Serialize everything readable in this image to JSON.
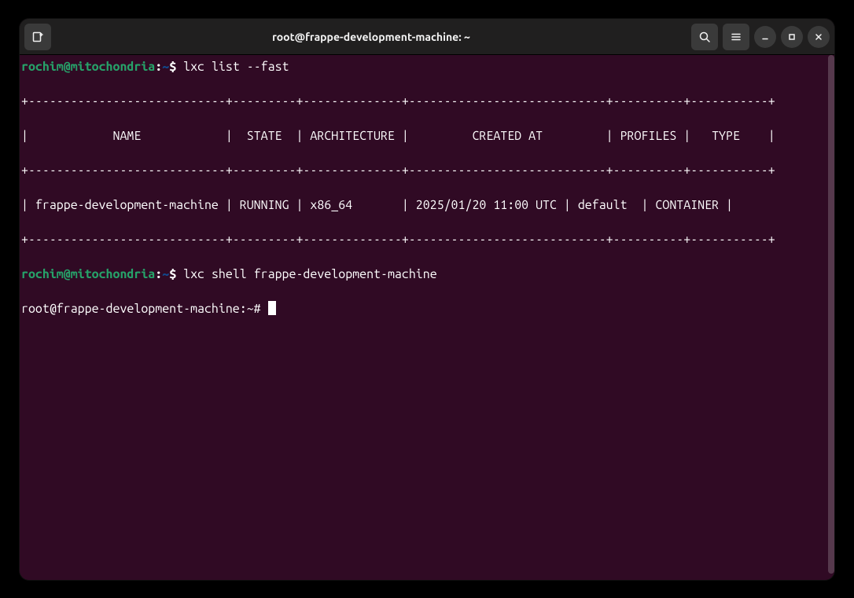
{
  "titlebar": {
    "title": "root@frappe-development-machine: ~"
  },
  "session": {
    "prompt1_user": "rochim@mitochondria",
    "prompt1_sep": ":",
    "prompt1_path": "~",
    "prompt1_dollar": "$ ",
    "command1": "lxc list --fast",
    "table_border": "+----------------------------+---------+--------------+----------------------------+----------+-----------+",
    "table_header": "|            NAME            |  STATE  | ARCHITECTURE |         CREATED AT         | PROFILES |   TYPE    |",
    "table_row": "| frappe-development-machine | RUNNING | x86_64       | 2025/01/20 11:00 UTC | default  | CONTAINER |",
    "prompt2_user": "rochim@mitochondria",
    "prompt2_sep": ":",
    "prompt2_path": "~",
    "prompt2_dollar": "$ ",
    "command2": "lxc shell frappe-development-machine",
    "prompt3": "root@frappe-development-machine:~# "
  },
  "table_data": {
    "columns": [
      "NAME",
      "STATE",
      "ARCHITECTURE",
      "CREATED AT",
      "PROFILES",
      "TYPE"
    ],
    "rows": [
      {
        "NAME": "frappe-development-machine",
        "STATE": "RUNNING",
        "ARCHITECTURE": "x86_64",
        "CREATED AT": "2025/01/20 11:00 UTC",
        "PROFILES": "default",
        "TYPE": "CONTAINER"
      }
    ]
  }
}
